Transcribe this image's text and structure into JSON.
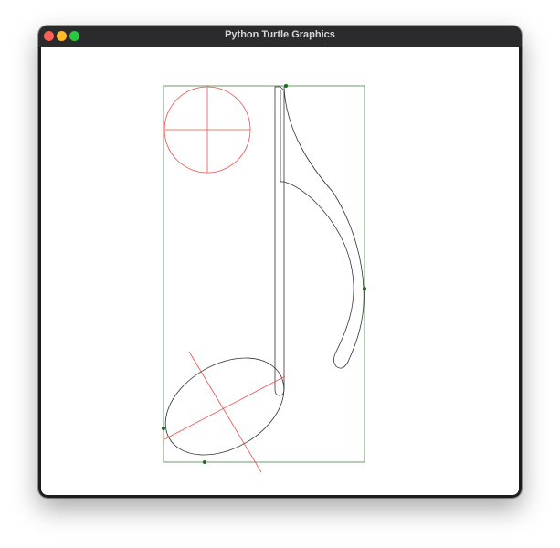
{
  "window": {
    "title": "Python Turtle Graphics"
  },
  "colors": {
    "titlebar": "#2b2a2d",
    "close": "#fe5f57",
    "minimize": "#febc2e",
    "maximize": "#28c840",
    "bounding_box": "#4a7f4a",
    "construction": "#e8504a",
    "outline": "#333333",
    "point": "#1d6b1d"
  },
  "canvas": {
    "drawing": "eighth-note-glyph"
  }
}
